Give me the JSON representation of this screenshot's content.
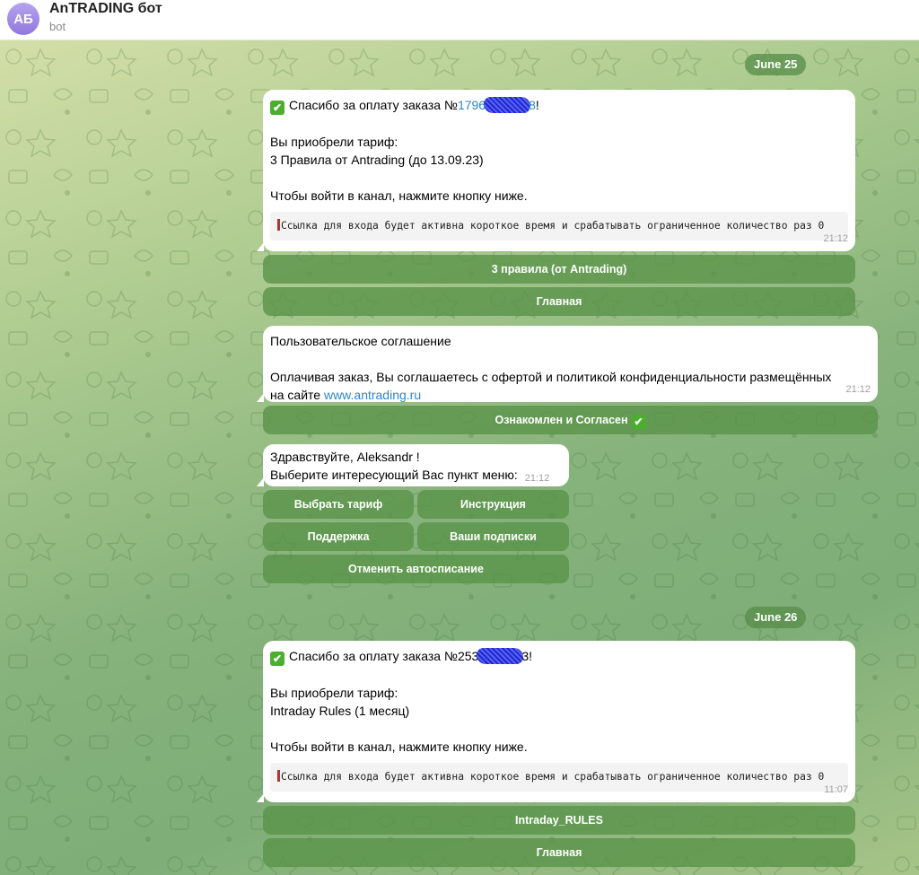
{
  "header": {
    "avatar_initials": "АБ",
    "title": "AnTRADING бот",
    "subtitle": "bot"
  },
  "day1": {
    "date": "June 25",
    "payment": {
      "check_icon": "✔",
      "title_prefix": "Спасибо за оплату заказа №",
      "order_visible_start": "1796",
      "order_visible_end": "8",
      "title_suffix": "!",
      "line1": "Вы приобрели тариф:",
      "line2": "3 Правила от Antrading (до 13.09.23)",
      "line3": "Чтобы войти в канал, нажмите кнопку ниже.",
      "notice": "Ссылка для входа будет активна короткое время и срабатывать ограниченное количество раз 0",
      "time": "21:12",
      "buttons": [
        "3 правила (от Antrading)",
        "Главная"
      ]
    },
    "agreement": {
      "title": "Пользовательское соглашение",
      "text": "Оплачивая заказ, Вы соглашаетесь с офертой и политикой конфиденциальности размещённых",
      "text2_prefix": "на сайте ",
      "link": "www.antrading.ru",
      "time": "21:12",
      "button": "Ознакомлен и Согласен",
      "button_icon": "✔"
    },
    "greeting": {
      "line1": "Здравствуйте, Aleksandr !",
      "line2": "Выберите интересующий Вас пункт меню:",
      "time": "21:12",
      "buttons": {
        "choose_plan": "Выбрать тариф",
        "instructions": "Инструкция",
        "support": "Поддержка",
        "subscriptions": "Ваши подписки",
        "cancel_autopay": "Отменить автосписание"
      }
    }
  },
  "day2": {
    "date": "June 26",
    "payment": {
      "check_icon": "✔",
      "title_prefix": "Спасибо за оплату заказа №",
      "order_visible_start": "253",
      "order_visible_end": "3",
      "title_suffix": "!",
      "line1": "Вы приобрели тариф:",
      "line2": "Intraday Rules (1 месяц)",
      "line3": "Чтобы войти в канал, нажмите кнопку ниже.",
      "notice": "Ссылка для входа будет активна короткое время и срабатывать ограниченное количество раз 0",
      "time": "11:07",
      "buttons": [
        "Intraday_RULES",
        "Главная"
      ]
    }
  }
}
